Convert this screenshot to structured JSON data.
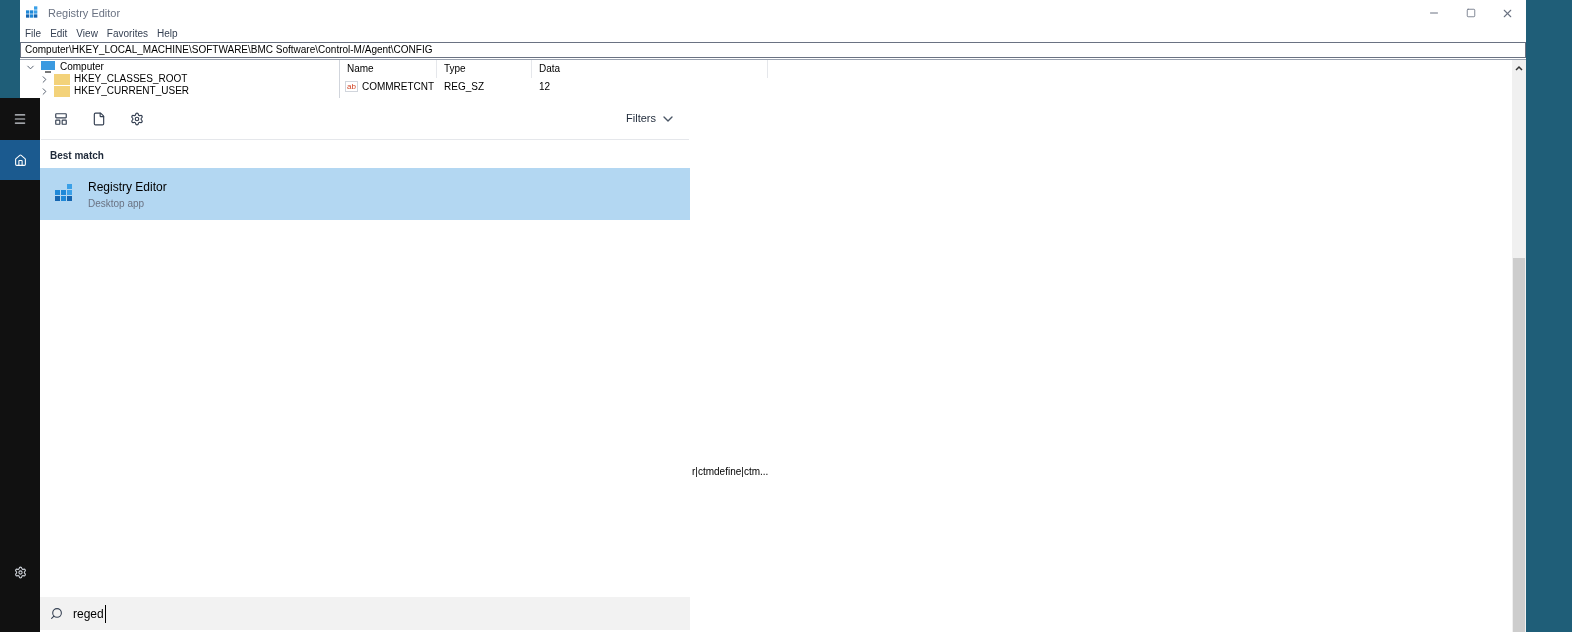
{
  "window": {
    "title": "Registry Editor"
  },
  "menu": [
    "File",
    "Edit",
    "View",
    "Favorites",
    "Help"
  ],
  "address": "Computer\\HKEY_LOCAL_MACHINE\\SOFTWARE\\BMC Software\\Control-M/Agent\\CONFIG",
  "tree": [
    {
      "label": "Computer",
      "expanded": true,
      "children": [
        {
          "label": "HKEY_CLASSES_ROOT",
          "expanded": false
        },
        {
          "label": "HKEY_CURRENT_USER",
          "expanded": false
        }
      ]
    }
  ],
  "columns": [
    "Name",
    "Type",
    "Data"
  ],
  "rows": [
    {
      "icon_text": "ab",
      "name": "COMMRETCNT",
      "type": "REG_SZ",
      "data": "12"
    }
  ],
  "partial_data": "r|ctmdefine|ctm...",
  "start": {
    "filters": "Filters",
    "section": "Best match",
    "results": [
      {
        "title": "Registry Editor",
        "subtitle": "Desktop app",
        "selected": true
      }
    ],
    "search": {
      "value": "reged"
    },
    "rail": [
      {
        "kind": "home",
        "selected": true
      }
    ]
  }
}
